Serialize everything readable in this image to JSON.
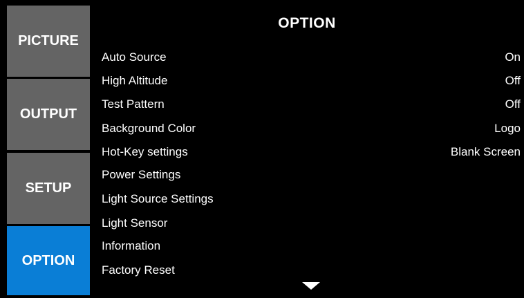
{
  "tabs": [
    {
      "label": "PICTURE",
      "active": false
    },
    {
      "label": "OUTPUT",
      "active": false
    },
    {
      "label": "SETUP",
      "active": false
    },
    {
      "label": "OPTION",
      "active": true
    }
  ],
  "panel": {
    "title": "OPTION",
    "items": [
      {
        "label": "Auto Source",
        "value": "On"
      },
      {
        "label": "High Altitude",
        "value": "Off"
      },
      {
        "label": "Test Pattern",
        "value": "Off"
      },
      {
        "label": "Background Color",
        "value": "Logo"
      },
      {
        "label": "Hot-Key settings",
        "value": "Blank Screen"
      },
      {
        "label": "Power Settings",
        "value": ""
      },
      {
        "label": "Light Source Settings",
        "value": ""
      },
      {
        "label": "Light Sensor",
        "value": ""
      },
      {
        "label": "Information",
        "value": ""
      },
      {
        "label": "Factory Reset",
        "value": ""
      }
    ],
    "scroll_icon": "triangle-down-icon"
  },
  "colors": {
    "background": "#000000",
    "tab_inactive": "#646464",
    "tab_active": "#0a7ed6",
    "text": "#ffffff"
  }
}
